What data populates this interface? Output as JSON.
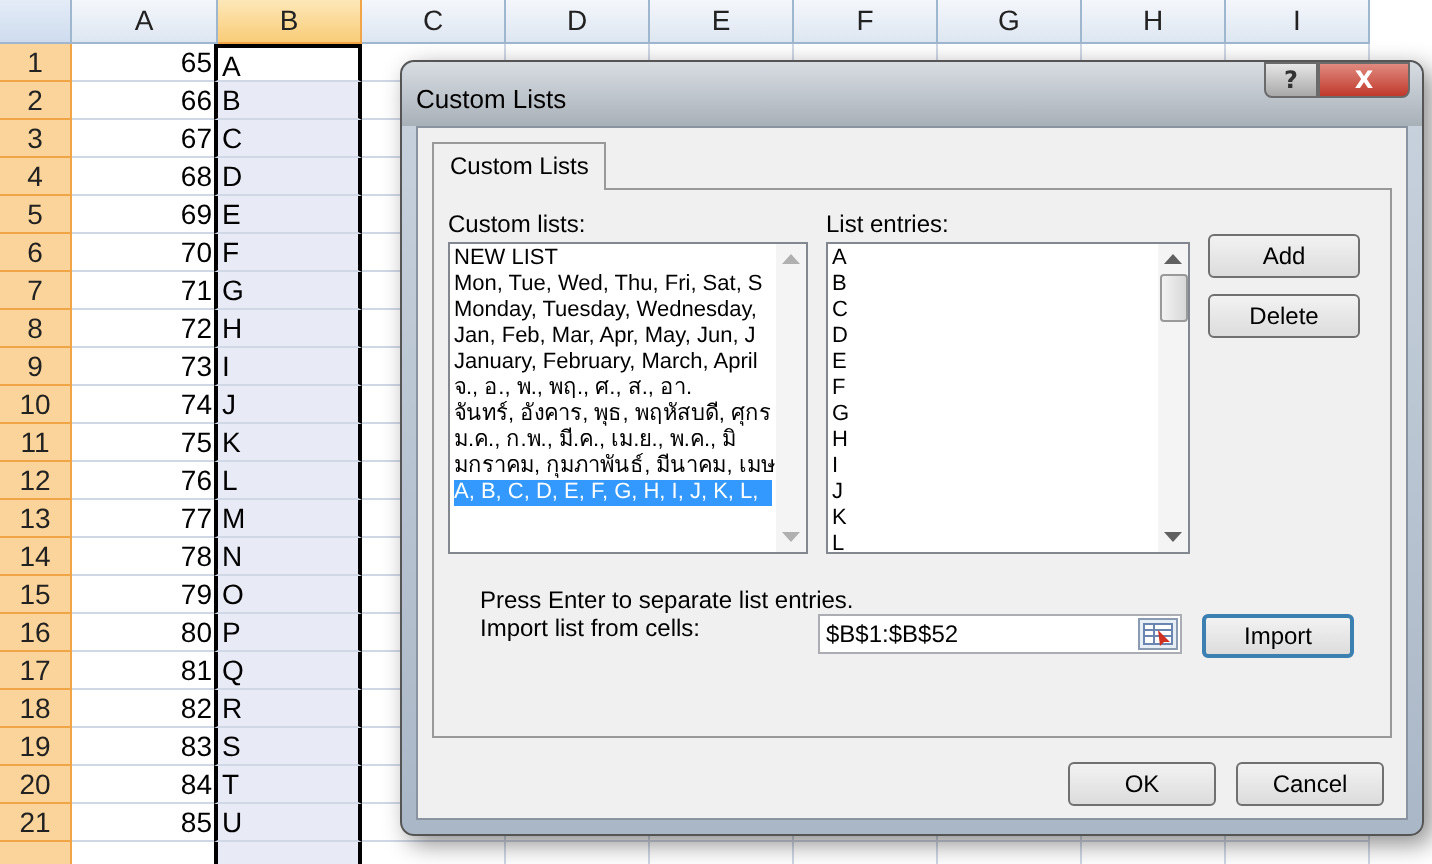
{
  "sheet": {
    "columns": [
      {
        "label": "A",
        "selected": false
      },
      {
        "label": "B",
        "selected": true
      },
      {
        "label": "C",
        "selected": false
      },
      {
        "label": "D",
        "selected": false
      },
      {
        "label": "E",
        "selected": false
      },
      {
        "label": "F",
        "selected": false
      },
      {
        "label": "G",
        "selected": false
      },
      {
        "label": "H",
        "selected": false
      },
      {
        "label": "I",
        "selected": false
      }
    ],
    "rows": [
      {
        "number": "1",
        "a": "65",
        "b": "A",
        "selected": true
      },
      {
        "number": "2",
        "a": "66",
        "b": "B",
        "selected": true
      },
      {
        "number": "3",
        "a": "67",
        "b": "C",
        "selected": true
      },
      {
        "number": "4",
        "a": "68",
        "b": "D",
        "selected": true
      },
      {
        "number": "5",
        "a": "69",
        "b": "E",
        "selected": true
      },
      {
        "number": "6",
        "a": "70",
        "b": "F",
        "selected": true
      },
      {
        "number": "7",
        "a": "71",
        "b": "G",
        "selected": true
      },
      {
        "number": "8",
        "a": "72",
        "b": "H",
        "selected": true
      },
      {
        "number": "9",
        "a": "73",
        "b": "I",
        "selected": true
      },
      {
        "number": "10",
        "a": "74",
        "b": "J",
        "selected": true
      },
      {
        "number": "11",
        "a": "75",
        "b": "K",
        "selected": true
      },
      {
        "number": "12",
        "a": "76",
        "b": "L",
        "selected": true
      },
      {
        "number": "13",
        "a": "77",
        "b": "M",
        "selected": true
      },
      {
        "number": "14",
        "a": "78",
        "b": "N",
        "selected": true
      },
      {
        "number": "15",
        "a": "79",
        "b": "O",
        "selected": true
      },
      {
        "number": "16",
        "a": "80",
        "b": "P",
        "selected": true
      },
      {
        "number": "17",
        "a": "81",
        "b": "Q",
        "selected": true
      },
      {
        "number": "18",
        "a": "82",
        "b": "R",
        "selected": true
      },
      {
        "number": "19",
        "a": "83",
        "b": "S",
        "selected": true
      },
      {
        "number": "20",
        "a": "84",
        "b": "T",
        "selected": true
      },
      {
        "number": "21",
        "a": "85",
        "b": "U",
        "selected": true
      }
    ]
  },
  "dialog": {
    "title": "Custom Lists",
    "help_button": "?",
    "close_button": "X",
    "tabs": [
      {
        "label": "Custom Lists",
        "selected": true
      }
    ],
    "custom_lists": {
      "label": "Custom lists:",
      "items": [
        {
          "text": "NEW LIST",
          "selected": false
        },
        {
          "text": "Mon, Tue, Wed, Thu, Fri, Sat, S",
          "selected": false
        },
        {
          "text": "Monday, Tuesday, Wednesday,",
          "selected": false
        },
        {
          "text": "Jan, Feb, Mar, Apr, May, Jun, J",
          "selected": false
        },
        {
          "text": "January, February, March, April",
          "selected": false
        },
        {
          "text": "จ., อ., พ., พฤ., ศ., ส., อา.",
          "selected": false
        },
        {
          "text": "จันทร์, อังคาร, พุธ, พฤหัสบดี, ศุกร",
          "selected": false
        },
        {
          "text": "ม.ค., ก.พ., มี.ค., เม.ย., พ.ค., มิ",
          "selected": false
        },
        {
          "text": "มกราคม, กุมภาพันธ์, มีนาคม, เมษ",
          "selected": false
        },
        {
          "text": "A, B, C, D, E, F, G, H, I, J, K, L,",
          "selected": true
        }
      ]
    },
    "list_entries": {
      "label": "List entries:",
      "items": [
        "A",
        "B",
        "C",
        "D",
        "E",
        "F",
        "G",
        "H",
        "I",
        "J",
        "K",
        "L"
      ]
    },
    "add_button": "Add",
    "delete_button": "Delete",
    "hint": "Press Enter to separate list entries.",
    "import_label": "Import list from cells:",
    "import_field": {
      "value": "$B$1:$B$52"
    },
    "import_button": "Import",
    "ok_button": "OK",
    "cancel_button": "Cancel"
  }
}
